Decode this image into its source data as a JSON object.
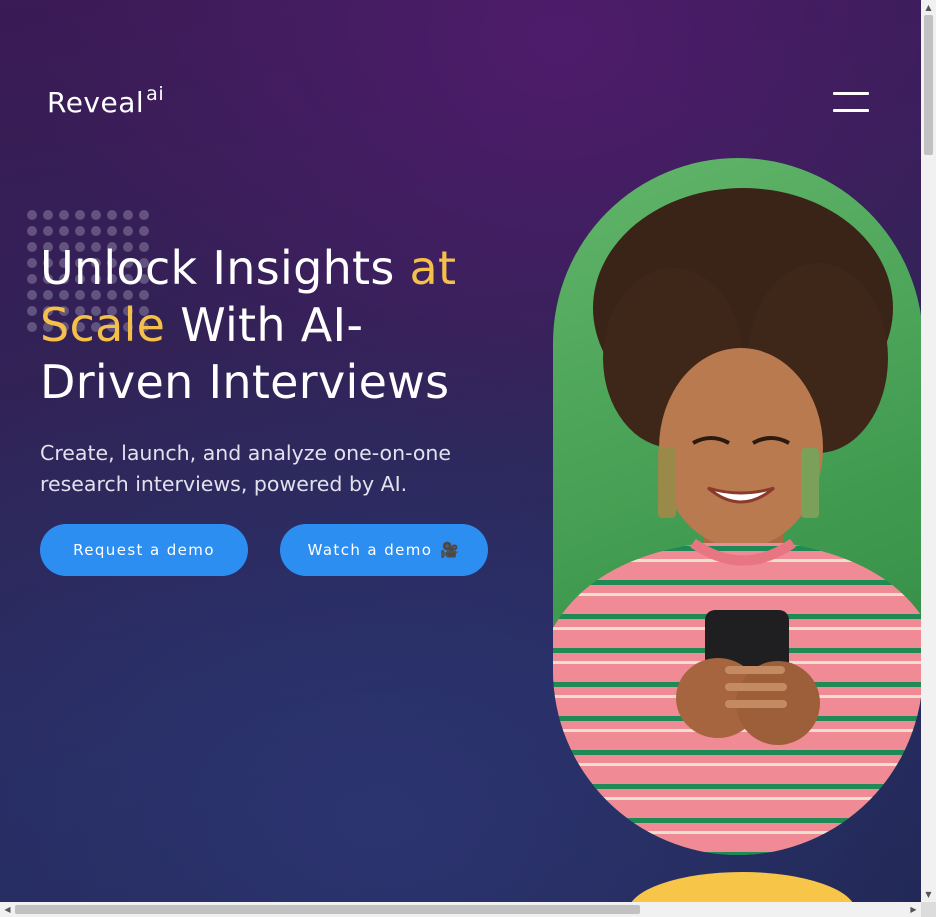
{
  "header": {
    "logo_text": "Reveal",
    "logo_sup": "ai",
    "menu_icon": "hamburger-menu-icon"
  },
  "hero": {
    "headline_part1": "Unlock Insights ",
    "headline_accent1": "at",
    "headline_accent2": "Scale",
    "headline_part2": " With AI-",
    "headline_part3": "Driven Interviews",
    "subtext": "Create, launch, and analyze one-on-one research interviews, powered by AI.",
    "buttons": {
      "request_demo": "Request a demo",
      "watch_demo": "Watch a demo",
      "watch_icon": "🎥"
    },
    "image_subject": "smiling woman in striped sweater using smartphone"
  },
  "colors": {
    "accent": "#f5c04a",
    "button": "#2b8ef0",
    "background": "#2f2456"
  }
}
